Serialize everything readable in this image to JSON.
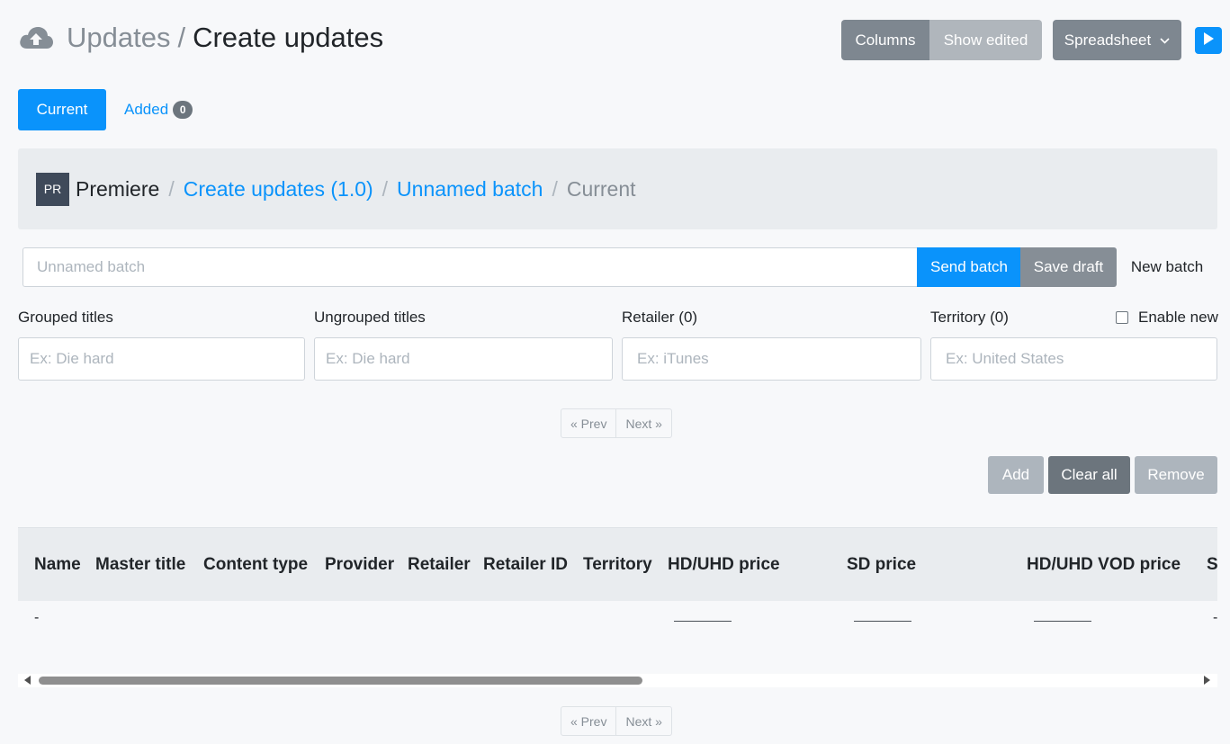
{
  "header": {
    "section": "Updates",
    "separator": "/",
    "title": "Create updates",
    "icon": "cloud-upload-icon"
  },
  "toolbar": {
    "columns_label": "Columns",
    "show_edited_label": "Show edited",
    "spreadsheet_label": "Spreadsheet",
    "spreadsheet_chevron": "⌄",
    "play_icon": "play-icon"
  },
  "tabs": [
    {
      "label": "Current"
    },
    {
      "label": "Added",
      "count": "0"
    }
  ],
  "breadcrumb": {
    "avatar": "PR",
    "root": "Premiere",
    "sep": "/",
    "items": [
      "Create updates (1.0)",
      "Unnamed batch"
    ],
    "current": "Current"
  },
  "batch": {
    "placeholder": "Unnamed batch",
    "send_label": "Send batch",
    "save_label": "Save draft",
    "new_label": "New batch"
  },
  "filters": {
    "grouped_label": "Grouped titles",
    "grouped_placeholder": "Ex: Die hard",
    "ungrouped_label": "Ungrouped titles",
    "ungrouped_placeholder": "Ex: Die hard",
    "retailer_label": "Retailer (0)",
    "retailer_placeholder": "Ex: iTunes",
    "territory_label": "Territory (0)",
    "territory_placeholder": "Ex: United States",
    "enable_new_label": "Enable new"
  },
  "pager": {
    "prev": "« Prev",
    "next": "Next »"
  },
  "actions": {
    "add": "Add",
    "clear_all": "Clear all",
    "remove": "Remove"
  },
  "table": {
    "columns": [
      "Name",
      "Master title",
      "Content type",
      "Provider",
      "Retailer",
      "Retailer ID",
      "Territory",
      "HD/UHD price",
      "SD price",
      "HD/UHD VOD price",
      "S"
    ],
    "rows": [
      {
        "name": "-",
        "last": "-"
      }
    ]
  }
}
